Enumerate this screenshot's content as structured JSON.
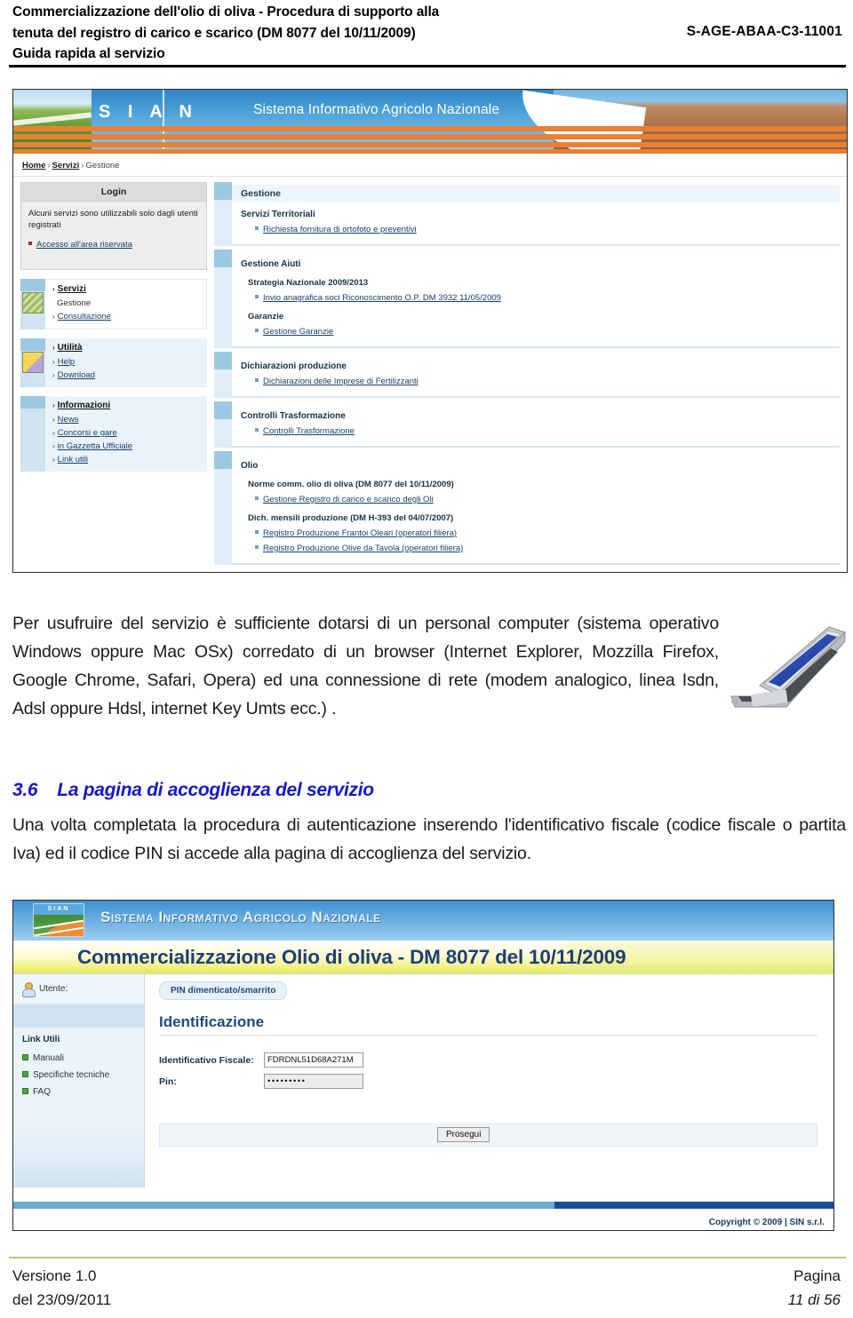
{
  "doc_header": {
    "line1": "Commercializzazione dell'olio di oliva - Procedura di supporto alla",
    "line2": "tenuta del registro di carico e scarico (DM 8077 del 10/11/2009)",
    "line3": "Guida rapida al servizio",
    "code": "S-AGE-ABAA-C3-11001"
  },
  "screenshot_portal": {
    "banner": {
      "logo": "S I A N",
      "title": "Sistema Informativo Agricolo Nazionale"
    },
    "breadcrumb": {
      "home": "Home",
      "servizi": "Servizi",
      "current": "Gestione",
      "separator": "›"
    },
    "login": {
      "header": "Login",
      "text": "Alcuni servizi sono utilizzabili solo dagli utenti registrati",
      "link": "Accesso all'area riservata"
    },
    "menus": [
      {
        "title": "Servizi",
        "items": [
          {
            "label": "Gestione",
            "link": false
          },
          {
            "label": "Consultazione",
            "link": true
          }
        ]
      },
      {
        "title": "Utilità",
        "items": [
          {
            "label": "Help",
            "link": true
          },
          {
            "label": "Download",
            "link": true
          }
        ]
      },
      {
        "title": "Informazioni",
        "items": [
          {
            "label": "News",
            "link": true
          },
          {
            "label": "Concorsi e gare",
            "link": true
          },
          {
            "label": "in Gazzetta Ufficiale",
            "link": true
          },
          {
            "label": "Link utili",
            "link": true
          }
        ]
      }
    ],
    "panels": [
      {
        "heading": "Gestione",
        "is_main_header": true,
        "groups": [
          {
            "title": "Servizi Territoriali",
            "sub": null,
            "links": [
              "Richiesta fornitura di ortofoto e preventivi"
            ]
          }
        ]
      },
      {
        "heading": "Gestione Aiuti",
        "is_main_header": false,
        "groups": [
          {
            "title": null,
            "sub": "Strategia Nazionale 2009/2013",
            "links": [
              "Invio anagrafica soci Riconoscimento O.P. DM 3932 11/05/2009"
            ]
          },
          {
            "title": null,
            "sub": "Garanzie",
            "links": [
              "Gestione Garanzie"
            ]
          }
        ]
      },
      {
        "heading": "Dichiarazioni produzione",
        "is_main_header": false,
        "groups": [
          {
            "title": null,
            "sub": null,
            "links": [
              "Dichiarazioni delle Imprese di Fertilizzanti"
            ]
          }
        ]
      },
      {
        "heading": "Controlli Trasformazione",
        "is_main_header": false,
        "groups": [
          {
            "title": null,
            "sub": null,
            "links": [
              "Controlli Trasformazione"
            ]
          }
        ]
      },
      {
        "heading": "Olio",
        "is_main_header": false,
        "groups": [
          {
            "title": null,
            "sub": "Norme comm. olio di oliva (DM 8077 del 10/11/2009)",
            "links": [
              "Gestione Registro di carico e scarico degli Oli"
            ]
          },
          {
            "title": null,
            "sub": "Dich. mensili produzione (DM H-393 del 04/07/2007)",
            "links": [
              "Registro Produzione Frantoi Oleari (operatori filiera)",
              "Registro Produzione Olive da Tavola (operatori filiera)"
            ]
          }
        ]
      }
    ]
  },
  "body": {
    "paragraph1": "Per usufruire del servizio è sufficiente dotarsi di un personal computer (sistema operativo Windows oppure Mac OSx) corredato di un browser (Internet Explorer, Mozzilla Firefox, Google Chrome, Safari, Opera) ed una connessione di rete (modem analogico, linea Isdn, Adsl oppure Hdsl, internet Key Umts ecc.) .",
    "heading_number": "3.6",
    "heading_text": "La pagina di accoglienza del servizio",
    "paragraph2": "Una volta completata la procedura di autenticazione inserendo l'identificativo fiscale (codice fiscale o partita Iva) ed il codice PIN si accede alla pagina di accoglienza del servizio."
  },
  "screenshot_login": {
    "logo_text": "SIAN",
    "sian_title": "Sistema Informativo Agricolo Nazionale",
    "doc_title": "Commercializzazione Olio di oliva - DM 8077 del 10/11/2009",
    "user_label": "Utente:",
    "links_title": "Link Utili",
    "links": [
      "Manuali",
      "Specifiche tecniche",
      "FAQ"
    ],
    "pin_button": "PIN dimenticato/smarrito",
    "form_title": "Identificazione",
    "fields": [
      {
        "label": "Identificativo Fiscale:",
        "value": "FDRDNL51D68A271M"
      },
      {
        "label": "Pin:",
        "value": "•••••••••"
      }
    ],
    "submit_button": "Prosegui",
    "copyright": "Copyright © 2009 | SIN s.r.l."
  },
  "doc_footer": {
    "version_line1": "Versione 1.0",
    "version_line2": "del 23/09/2011",
    "page_label": "Pagina",
    "page_value": "11 di 56"
  }
}
